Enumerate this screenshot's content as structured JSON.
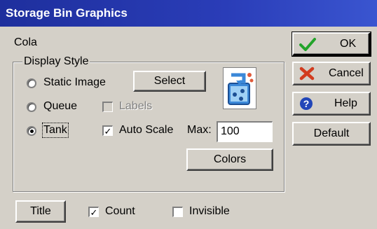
{
  "window": {
    "title": "Storage Bin Graphics"
  },
  "item_name": "Cola",
  "display_style": {
    "legend": "Display Style",
    "options": [
      {
        "label": "Static Image",
        "selected": false
      },
      {
        "label": "Queue",
        "selected": false
      },
      {
        "label": "Tank",
        "selected": true
      }
    ],
    "select_label": "Select",
    "labels_checkbox": {
      "label": "Labels",
      "checked": false,
      "enabled": false
    },
    "auto_scale": {
      "label": "Auto Scale",
      "checked": true
    },
    "max_label": "Max:",
    "max_value": "100",
    "colors_label": "Colors",
    "preview_icon": "storage-bin-icon"
  },
  "bottom": {
    "title_label": "Title",
    "count": {
      "label": "Count",
      "checked": true
    },
    "invisible": {
      "label": "Invisible",
      "checked": false
    }
  },
  "buttons": {
    "ok_label": "OK",
    "cancel_label": "Cancel",
    "help_label": "Help",
    "default_label": "Default"
  },
  "colors": {
    "titlebar": "#1e2f9d",
    "face": "#d4d0c8",
    "ok_check": "#22a32a",
    "cancel_x": "#d23c1e",
    "help_circle": "#2246b8"
  }
}
